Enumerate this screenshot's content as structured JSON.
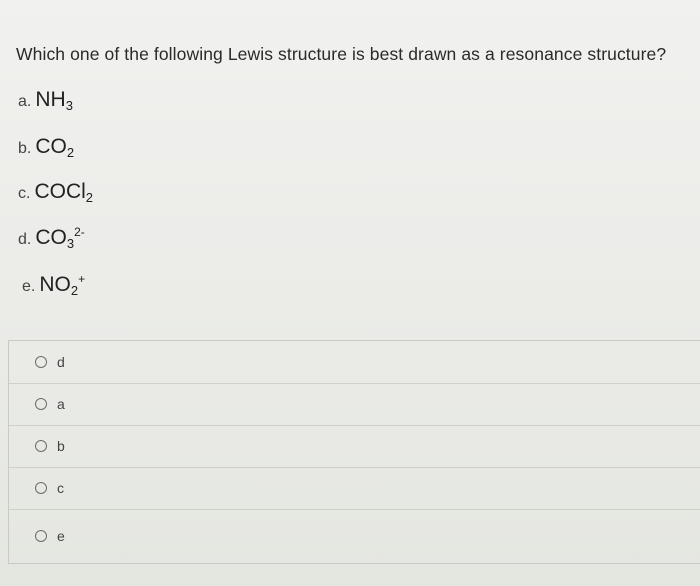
{
  "question": "Which one of the following Lewis structure is best drawn as a resonance structure?",
  "options": [
    {
      "prefix": "a.",
      "formula": "NH",
      "sub": "3",
      "sup": ""
    },
    {
      "prefix": "b.",
      "formula": "CO",
      "sub": "2",
      "sup": ""
    },
    {
      "prefix": "c.",
      "formula": "COCl",
      "sub": "2",
      "sup": ""
    },
    {
      "prefix": "d.",
      "formula": "CO",
      "sub": "3",
      "sup": "2-"
    },
    {
      "prefix": "e.",
      "formula": "NO",
      "sub": "2",
      "sup": "+"
    }
  ],
  "choices": [
    {
      "label": "d"
    },
    {
      "label": "a"
    },
    {
      "label": "b"
    },
    {
      "label": "c"
    },
    {
      "label": "e"
    }
  ]
}
